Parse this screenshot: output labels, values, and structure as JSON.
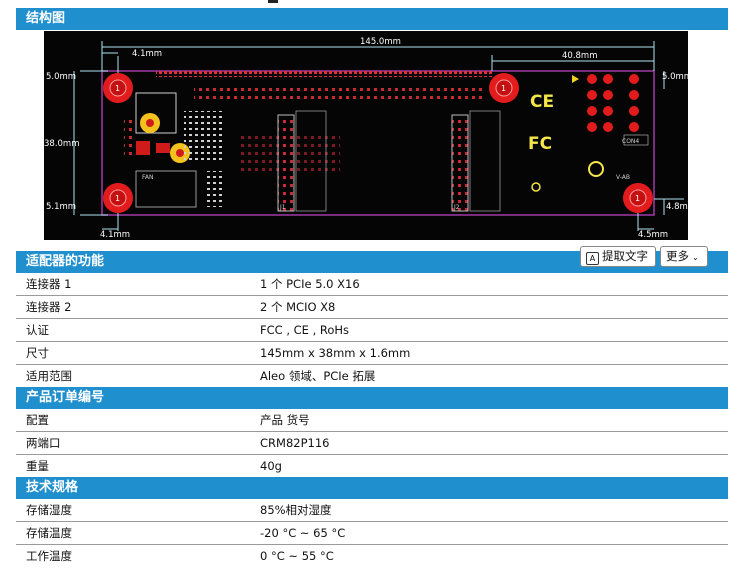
{
  "sections": {
    "structure": "结构图",
    "functions": "适配器的功能",
    "ordering": "产品订单编号",
    "specs": "技术规格"
  },
  "diagram": {
    "dims": {
      "total_width": "145.0mm",
      "right_span": "40.8mm",
      "left_top": "4.1mm",
      "left_bottom": "4.1mm",
      "top_left": "5.0mm",
      "top_right": "5.0mm",
      "height": "38.0mm",
      "bottom_left": "5.1mm",
      "bottom_right": "4.8mm",
      "bottom_right_h": "4.5mm"
    },
    "marks": {
      "ce": "CE",
      "fc": "FC",
      "hole": "1",
      "con": "CON4",
      "j1": "J1",
      "j2": "J2",
      "vaa": "V-AB",
      "faa": "FAN"
    }
  },
  "toolbar": {
    "extract_text": "提取文字",
    "more": "更多"
  },
  "functions": [
    {
      "key": "连接器 1",
      "value": "1 个 PCIe 5.0 X16"
    },
    {
      "key": "连接器 2",
      "value": "2 个 MCIO X8"
    },
    {
      "key": "认证",
      "value": "FCC , CE , RoHs"
    },
    {
      "key": "尺寸",
      "value": "145mm x 38mm x 1.6mm"
    },
    {
      "key": "适用范围",
      "value": "Aleo 领域、PCIe 拓展"
    }
  ],
  "ordering": [
    {
      "key": "配置",
      "value": "产品 货号"
    },
    {
      "key": "两端口",
      "value": "CRM82P116"
    },
    {
      "key": "重量",
      "value": "40g"
    }
  ],
  "specs": [
    {
      "key": "存储湿度",
      "value": "85%相对湿度"
    },
    {
      "key": "存储温度",
      "value": "-20 °C ~ 65 °C"
    },
    {
      "key": "工作温度",
      "value": "0 °C ~ 55 °C"
    }
  ]
}
